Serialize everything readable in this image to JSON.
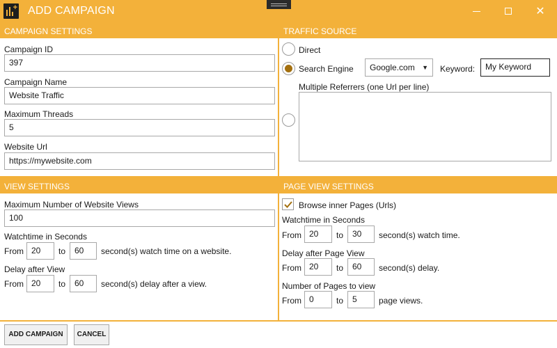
{
  "window": {
    "title": "ADD CAMPAIGN"
  },
  "campaign_settings": {
    "header": "CAMPAIGN SETTINGS",
    "campaign_id_label": "Campaign ID",
    "campaign_id": "397",
    "campaign_name_label": "Campaign Name",
    "campaign_name": "Website Traffic",
    "max_threads_label": "Maximum Threads",
    "max_threads": "5",
    "website_url_label": "Website Url",
    "website_url": "https://mywebsite.com"
  },
  "traffic_source": {
    "header": "TRAFFIC SOURCE",
    "direct_label": "Direct",
    "direct_selected": false,
    "search_engine_label": "Search Engine",
    "search_engine_selected": true,
    "search_engine_value": "Google.com",
    "keyword_label": "Keyword:",
    "keyword_value": "My Keyword",
    "referrers_label": "Multiple Referrers (one Url per line)",
    "referrers_selected": false,
    "referrers_value": ""
  },
  "view_settings": {
    "header": "VIEW SETTINGS",
    "max_views_label": "Maximum Number of Website Views",
    "max_views": "100",
    "watchtime_label": "Watchtime in Seconds",
    "from_label": "From",
    "to_label": "to",
    "watch_from": "20",
    "watch_to": "60",
    "watch_suffix": "second(s) watch time on a website.",
    "delay_label": "Delay after View",
    "delay_from": "20",
    "delay_to": "60",
    "delay_suffix": "second(s) delay after a view."
  },
  "page_view_settings": {
    "header": "PAGE VIEW SETTINGS",
    "browse_inner_label": "Browse inner Pages (Urls)",
    "browse_inner_checked": true,
    "watchtime_label": "Watchtime in Seconds",
    "from_label": "From",
    "to_label": "to",
    "watch_from": "20",
    "watch_to": "30",
    "watch_suffix": "second(s) watch time.",
    "delay_label": "Delay after Page View",
    "delay_from": "20",
    "delay_to": "60",
    "delay_suffix": "second(s) delay.",
    "pages_label": "Number of Pages to view",
    "pages_from": "0",
    "pages_to": "5",
    "pages_suffix": "page views."
  },
  "footer": {
    "add_label": "ADD CAMPAIGN",
    "cancel_label": "CANCEL"
  },
  "colors": {
    "accent": "#f3b13a",
    "radio_fill": "#a4700f"
  }
}
